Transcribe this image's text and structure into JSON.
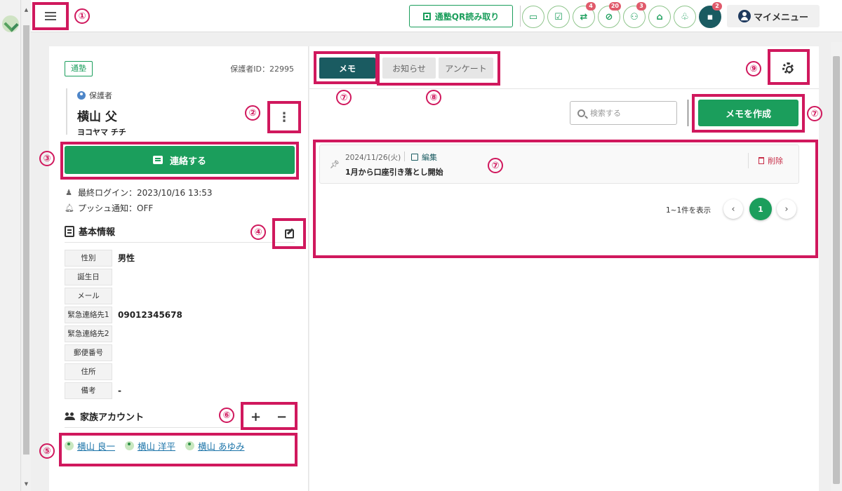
{
  "topbar": {
    "qr_button_label": "通塾QR読み取り",
    "badges": [
      "4",
      "20",
      "3",
      "2"
    ],
    "my_menu_label": "マイメニュー"
  },
  "guardian": {
    "school_tag": "通塾",
    "guardian_id": "保護者ID：22995",
    "role": "保護者",
    "name": "横山 父",
    "kana": "ヨコヤマ チチ",
    "contact_label": "連絡する",
    "last_login": "最終ログイン：2023/10/16 13:53",
    "push": "プッシュ通知：OFF"
  },
  "basic_info": {
    "title": "基本情報",
    "rows": [
      {
        "label": "性別",
        "value": "男性"
      },
      {
        "label": "誕生日",
        "value": ""
      },
      {
        "label": "メール",
        "value": ""
      },
      {
        "label": "緊急連絡先1",
        "value": "09012345678"
      },
      {
        "label": "緊急連絡先2",
        "value": ""
      },
      {
        "label": "郵便番号",
        "value": ""
      },
      {
        "label": "住所",
        "value": ""
      },
      {
        "label": "備考",
        "value": "-"
      }
    ]
  },
  "family": {
    "title": "家族アカウント",
    "add": "+",
    "remove": "−",
    "members": [
      "横山 良一",
      "横山 洋平",
      "横山 あゆみ"
    ]
  },
  "tabs": [
    "メモ",
    "お知らせ",
    "アンケート"
  ],
  "search_placeholder": "検索する",
  "create_memo_label": "メモを作成",
  "memo": {
    "date": "2024/11/26(火)",
    "edit": "編集",
    "text": "1月から口座引き落とし開始",
    "delete": "削除"
  },
  "pager": {
    "summary": "1~1件を表示",
    "current": "1",
    "prev": "‹",
    "next": "›"
  },
  "annotations": [
    "①",
    "②",
    "③",
    "④",
    "⑤",
    "⑥",
    "⑦",
    "⑧",
    "⑨"
  ],
  "colors": {
    "accent": "#1b9e5c",
    "dark_teal": "#1a5b61",
    "highlight": "#d0185d",
    "danger": "#c72e48"
  }
}
